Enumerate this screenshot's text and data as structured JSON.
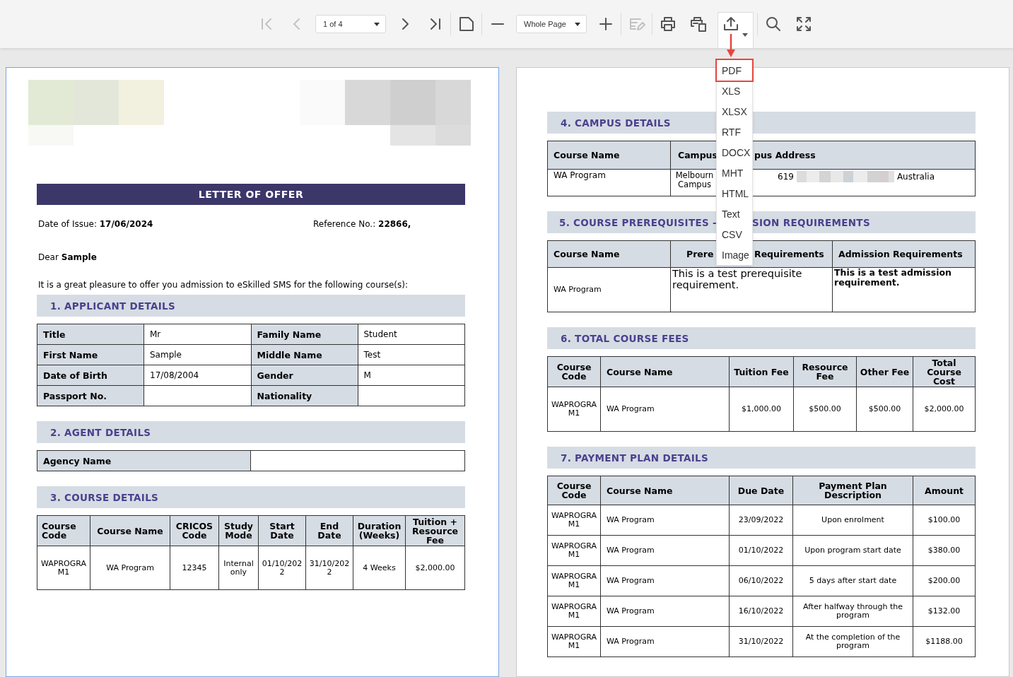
{
  "toolbar": {
    "groups": [
      [
        {
          "kind": "first-page",
          "disabled": true
        },
        {
          "kind": "previous-page",
          "disabled": true
        },
        {
          "kind": "page-select",
          "value": "1 of 4",
          "disabled": false
        },
        {
          "kind": "next-page",
          "disabled": false
        },
        {
          "kind": "last-page",
          "disabled": false
        }
      ],
      [
        {
          "kind": "single-page",
          "disabled": false
        }
      ],
      [
        {
          "kind": "zoom-out",
          "disabled": false
        },
        {
          "kind": "zoom-select",
          "value": "Whole Page",
          "disabled": false
        },
        {
          "kind": "zoom-in",
          "disabled": false
        }
      ],
      [
        {
          "kind": "edit-form",
          "disabled": true
        }
      ],
      [
        {
          "kind": "print",
          "disabled": false
        },
        {
          "kind": "print-page",
          "disabled": false
        },
        {
          "kind": "export",
          "disabled": false,
          "expanded": true
        }
      ],
      [
        {
          "kind": "search",
          "disabled": false
        },
        {
          "kind": "full-screen",
          "disabled": false
        }
      ]
    ]
  },
  "export_menu": {
    "items": [
      {
        "label": "PDF",
        "selected": true
      },
      {
        "label": "XLS",
        "selected": false
      },
      {
        "label": "XLSX",
        "selected": false
      },
      {
        "label": "RTF",
        "selected": false
      },
      {
        "label": "DOCX",
        "selected": false
      },
      {
        "label": "MHT",
        "selected": false
      },
      {
        "label": "HTML",
        "selected": false
      },
      {
        "label": "Text",
        "selected": false
      },
      {
        "label": "CSV",
        "selected": false
      },
      {
        "label": "Image",
        "selected": false
      }
    ]
  },
  "pages": [
    {
      "selected": true,
      "blocks": [
        {
          "kind": "logos"
        },
        {
          "kind": "banner",
          "text": "LETTER OF OFFER"
        },
        {
          "kind": "meta",
          "items": [
            "Date of Issue: **17/06/2024**",
            "Reference No.: **22866,**"
          ]
        },
        {
          "kind": "paragraph",
          "text": "Dear **Sample**"
        },
        {
          "kind": "paragraph",
          "text": "It is a great pleasure to offer you admission to eSkilled SMS for the following course(s):"
        },
        {
          "kind": "section",
          "title": "1. APPLICANT DETAILS"
        },
        {
          "kind": "fields",
          "rows": [
            [
              {
                "label": "Title",
                "value": "Mr"
              },
              {
                "label": "Family Name",
                "value": "Student"
              }
            ],
            [
              {
                "label": "First Name",
                "value": "Sample"
              },
              {
                "label": "Middle Name",
                "value": "Test"
              }
            ],
            [
              {
                "label": "Date of Birth",
                "value": "17/08/2004"
              },
              {
                "label": "Gender",
                "value": "M"
              }
            ],
            [
              {
                "label": "Passport No."
              },
              {
                "label": "Nationality"
              }
            ]
          ]
        },
        {
          "kind": "section",
          "title": "2. AGENT DETAILS"
        },
        {
          "kind": "fields",
          "rows": [
            [
              {
                "label": "Agency Name"
              }
            ]
          ]
        },
        {
          "kind": "section",
          "title": "3. COURSE DETAILS"
        },
        {
          "kind": "grid",
          "columns": [
            "Course Code",
            "Course Name",
            "CRICOS Code",
            "Study Mode",
            "Start Date",
            "End Date",
            "Duration (Weeks)",
            "Tuition + Resource Fee"
          ],
          "rows": [
            [
              "WAPROGRAM1",
              "WA Program",
              "12345",
              "Internal only",
              "01/10/2022",
              "31/10/2022",
              "4 Weeks",
              "$2,000.00"
            ]
          ]
        }
      ]
    },
    {
      "selected": false,
      "blocks": [
        {
          "kind": "section",
          "title": "4. CAMPUS DETAILS"
        },
        {
          "kind": "grid",
          "columns": [
            "Course Name",
            "Campus",
            "pus Address"
          ],
          "rows": [
            [
              "WA Program",
              "Melbourn Campus",
              {
                "kind": "address",
                "before": "619",
                "after": "Australia"
              }
            ]
          ]
        },
        {
          "kind": "section",
          "parts": [
            "5. COURSE PREREQUISITES -",
            "SION REQUIREMENTS"
          ]
        },
        {
          "kind": "grid",
          "columns": [
            "Course Name",
            {
              "parts": [
                "Prere",
                "Requirements"
              ]
            },
            "Admission Requirements"
          ],
          "rows": [
            [
              "WA Program",
              "This is a test prerequisite requirement.",
              "This is a test admission requirement."
            ]
          ]
        },
        {
          "kind": "section",
          "title": "6. TOTAL COURSE FEES"
        },
        {
          "kind": "grid",
          "columns": [
            "Course Code",
            "Course Name",
            "Tuition Fee",
            "Resource Fee",
            "Other Fee",
            "Total Course Cost"
          ],
          "rows": [
            [
              "WAPROGRAM1",
              "WA Program",
              "$1,000.00",
              "$500.00",
              "$500.00",
              "$2,000.00"
            ]
          ]
        },
        {
          "kind": "section",
          "title": "7. PAYMENT PLAN DETAILS"
        },
        {
          "kind": "grid",
          "columns": [
            "Course Code",
            "Course Name",
            "Due Date",
            "Payment Plan Description",
            "Amount"
          ],
          "rows": [
            [
              "WAPROGRAM1",
              "WA Program",
              "23/09/2022",
              "Upon enrolment",
              "$100.00"
            ],
            [
              "WAPROGRAM1",
              "WA Program",
              "01/10/2022",
              "Upon program start date",
              "$380.00"
            ],
            [
              "WAPROGRAM1",
              "WA Program",
              "06/10/2022",
              "5 days after start date",
              "$200.00"
            ],
            [
              "WAPROGRAM1",
              "WA Program",
              "16/10/2022",
              "After halfway through the program",
              "$132.00"
            ],
            [
              "WAPROGRAM1",
              "WA Program",
              "31/10/2022",
              "At the completion of the program",
              "$1188.00"
            ]
          ]
        }
      ]
    }
  ]
}
